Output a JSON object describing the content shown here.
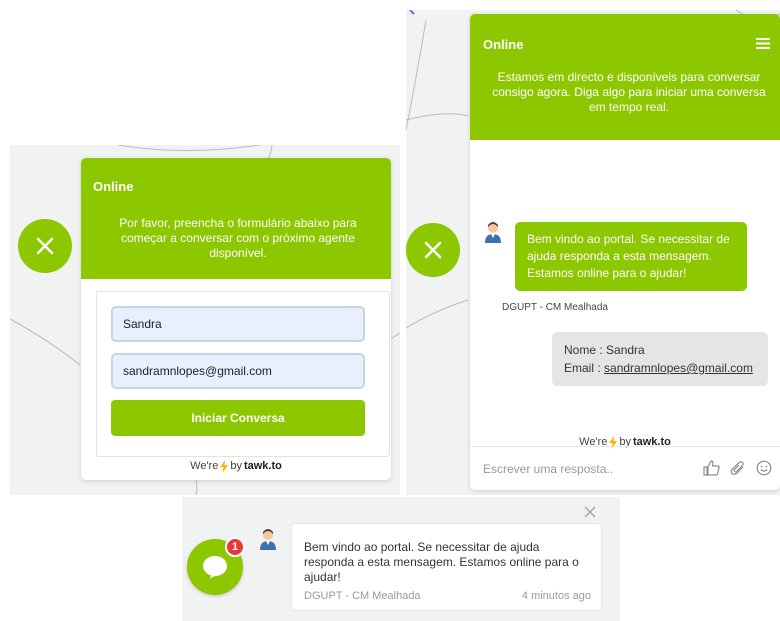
{
  "form_widget": {
    "status": "Online",
    "header_message": "Por favor, preencha o formulário abaixo para começar a conversar com o próximo agente disponível.",
    "name_value": "Sandra",
    "email_value": "sandramnlopes@gmail.com",
    "submit_label": "Iniciar Conversa",
    "branding_prefix": "We're",
    "branding_by": "by",
    "branding_name": "tawk.to"
  },
  "chat_widget": {
    "status": "Online",
    "header_message": "Estamos em directo e disponíveis para conversar consigo agora. Diga algo para iniciar uma conversa em tempo real.",
    "agent_message": "Bem vindo ao portal. Se necessitar de ajuda responda a esta mensagem. Estamos online para o ajudar!",
    "agent_name": "DGUPT - CM Mealhada",
    "visitor_name_label": "Nome :",
    "visitor_name": "Sandra",
    "visitor_email_label": "Email :",
    "visitor_email": "sandramnlopes@gmail.com",
    "branding_prefix": "We're",
    "branding_by": "by",
    "branding_name": "tawk.to",
    "composer_placeholder": "Escrever uma resposta.."
  },
  "notification": {
    "badge_count": "1",
    "message": "Bem vindo ao portal. Se necessitar de ajuda responda a esta mensagem. Estamos online para o ajudar!",
    "agent_name": "DGUPT - CM Mealhada",
    "time_ago": "4 minutos ago"
  },
  "colors": {
    "accent": "#8cc700",
    "badge": "#e8383d",
    "map_background": "#f1f2f2"
  },
  "icons": [
    "close-icon",
    "menu-icon",
    "agent-avatar-icon",
    "lightning-icon",
    "thumbs-up-icon",
    "attachment-icon",
    "emoji-icon",
    "chat-bubble-icon"
  ]
}
